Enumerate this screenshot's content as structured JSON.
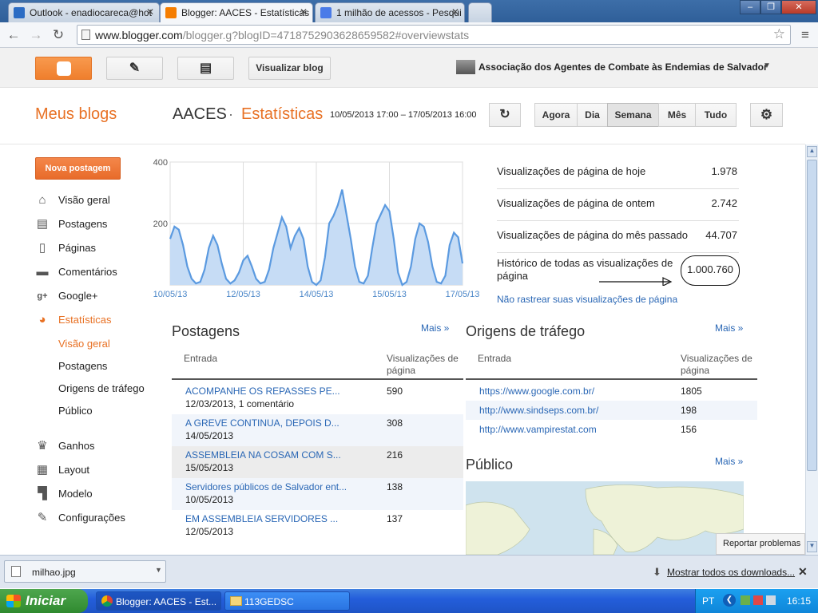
{
  "browser": {
    "tabs": [
      {
        "label": "Outlook - enadiocareca@hot",
        "favicon_color": "#2b6cc4"
      },
      {
        "label": "Blogger: AACES - Estatísticas",
        "favicon_color": "#f57d00"
      },
      {
        "label": "1 milhão de acessos - Pesqui",
        "favicon_color": "#4a7be8"
      }
    ],
    "url_host": "www.blogger.com",
    "url_path": "/blogger.g?blogID=4718752903628659582#overviewstats"
  },
  "header": {
    "view_blog": "Visualizar blog",
    "org_name": "Associação dos Agentes de Combate às Endemias de Salvador"
  },
  "title": {
    "my_blogs": "Meus blogs",
    "blog": "AACES",
    "dot": "·",
    "section": "Estatísticas",
    "range": "10/05/2013 17:00 – 17/05/2013 16:00"
  },
  "periods": [
    "Agora",
    "Dia",
    "Semana",
    "Mês",
    "Tudo"
  ],
  "selected_period": "Semana",
  "sidebar": {
    "new_post": "Nova postagem",
    "items": [
      {
        "label": "Visão geral",
        "icon": "home-icon"
      },
      {
        "label": "Postagens",
        "icon": "posts-icon"
      },
      {
        "label": "Páginas",
        "icon": "pages-icon"
      },
      {
        "label": "Comentários",
        "icon": "comment-icon"
      },
      {
        "label": "Google+",
        "icon": "googleplus-icon"
      },
      {
        "label": "Estatísticas",
        "icon": "stats-pie-icon"
      }
    ],
    "sub_items": [
      "Visão geral",
      "Postagens",
      "Origens de tráfego",
      "Público"
    ],
    "items2": [
      {
        "label": "Ganhos",
        "icon": "trophy-icon"
      },
      {
        "label": "Layout",
        "icon": "layout-icon"
      },
      {
        "label": "Modelo",
        "icon": "template-icon"
      },
      {
        "label": "Configurações",
        "icon": "wrench-icon"
      }
    ]
  },
  "chart_data": {
    "type": "area",
    "x_ticks": [
      "10/05/13",
      "12/05/13",
      "14/05/13",
      "15/05/13",
      "17/05/13"
    ],
    "y_ticks": [
      200,
      400
    ],
    "ylim": [
      0,
      400
    ],
    "values": [
      150,
      190,
      180,
      130,
      60,
      20,
      5,
      10,
      50,
      120,
      160,
      130,
      70,
      20,
      5,
      15,
      40,
      80,
      95,
      60,
      20,
      5,
      10,
      50,
      120,
      170,
      220,
      190,
      120,
      160,
      185,
      150,
      60,
      10,
      0,
      15,
      90,
      200,
      225,
      260,
      310,
      230,
      150,
      60,
      10,
      5,
      30,
      120,
      200,
      230,
      260,
      240,
      150,
      40,
      0,
      10,
      60,
      150,
      200,
      190,
      140,
      60,
      10,
      5,
      30,
      130,
      170,
      155,
      70
    ]
  },
  "stats": [
    {
      "label": "Visualizações de página de hoje",
      "value": "1.978"
    },
    {
      "label": "Visualizações de página de ontem",
      "value": "2.742"
    },
    {
      "label": "Visualizações de página do mês passado",
      "value": "44.707"
    },
    {
      "label": "Histórico de todas as visualizações de página",
      "value": "1.000.760"
    }
  ],
  "no_track": "Não rastrear suas visualizações de página",
  "posts": {
    "title": "Postagens",
    "more": "Mais »",
    "col_entry": "Entrada",
    "col_views": "Visualizações de página",
    "rows": [
      {
        "title": "ACOMPANHE OS REPASSES PE...",
        "meta": "12/03/2013, 1 comentário",
        "views": "590"
      },
      {
        "title": "A GREVE CONTINUA, DEPOIS D...",
        "meta": "14/05/2013",
        "views": "308"
      },
      {
        "title": "ASSEMBLEIA NA COSAM COM S...",
        "meta": "15/05/2013",
        "views": "216"
      },
      {
        "title": "Servidores públicos de Salvador ent...",
        "meta": "10/05/2013",
        "views": "138"
      },
      {
        "title": "EM ASSEMBLEIA SERVIDORES ...",
        "meta": "12/05/2013",
        "views": "137"
      }
    ]
  },
  "traffic": {
    "title": "Origens de tráfego",
    "more": "Mais »",
    "col_entry": "Entrada",
    "col_views": "Visualizações de página",
    "rows": [
      {
        "url": "https://www.google.com.br/",
        "views": "1805"
      },
      {
        "url": "http://www.sindseps.com.br/",
        "views": "198"
      },
      {
        "url": "http://www.vampirestat.com",
        "views": "156"
      }
    ]
  },
  "audience": {
    "title": "Público",
    "more": "Mais »"
  },
  "report": "Reportar problemas",
  "download": {
    "file": "milhao.jpg",
    "show_all": "Mostrar todos os downloads..."
  },
  "taskbar": {
    "start": "Iniciar",
    "tasks": [
      "Blogger: AACES - Est...",
      "113GEDSC"
    ],
    "lang": "PT",
    "clock": "16:15"
  }
}
